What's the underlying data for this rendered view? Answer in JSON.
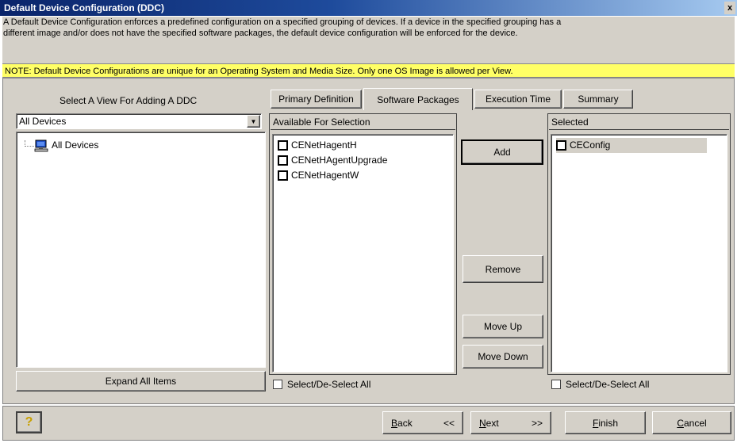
{
  "window": {
    "title": "Default Device Configuration (DDC)",
    "close_glyph": "x"
  },
  "description": {
    "line1": "A Default Device Configuration enforces a predefined configuration on a specified grouping of devices.  If a device in the specified grouping has a",
    "line2": "different image and/or does not have the specified software packages, the default device configuration will be enforced for the device."
  },
  "note": "NOTE: Default Device Configurations are unique for an Operating System and Media Size.  Only one OS Image is allowed per View.",
  "left_panel": {
    "heading": "Select A View For Adding A DDC",
    "view_select": {
      "value": "All Devices"
    },
    "tree": [
      {
        "label": "All Devices",
        "icon": "computer-icon"
      }
    ],
    "expand_button": "Expand All Items"
  },
  "tabs": [
    {
      "label": "Primary Definition",
      "active": false
    },
    {
      "label": "Software Packages",
      "active": true
    },
    {
      "label": "Execution Time",
      "active": false
    },
    {
      "label": "Summary",
      "active": false
    }
  ],
  "available": {
    "header": "Available For Selection",
    "items": [
      "CENetHagentH",
      "CENetHAgentUpgrade",
      "CENetHagentW"
    ],
    "select_all": "Select/De-Select All"
  },
  "actions": {
    "add": "Add",
    "remove": "Remove",
    "move_up": "Move Up",
    "move_down": "Move Down"
  },
  "selected": {
    "header": "Selected",
    "items": [
      "CEConfig"
    ],
    "select_all": "Select/De-Select All"
  },
  "footer": {
    "help_glyph": "?",
    "back": {
      "letter": "B",
      "rest": "ack",
      "arrows": "<<"
    },
    "next": {
      "letter": "N",
      "rest": "ext",
      "arrows": ">>"
    },
    "finish": {
      "letter": "F",
      "rest": "inish"
    },
    "cancel": {
      "letter": "C",
      "rest": "ancel"
    }
  },
  "colors": {
    "title_bar": "#0a246a",
    "note_bg": "#ffff66",
    "face": "#d4d0c8",
    "selected_row": "#d4d0c8"
  }
}
